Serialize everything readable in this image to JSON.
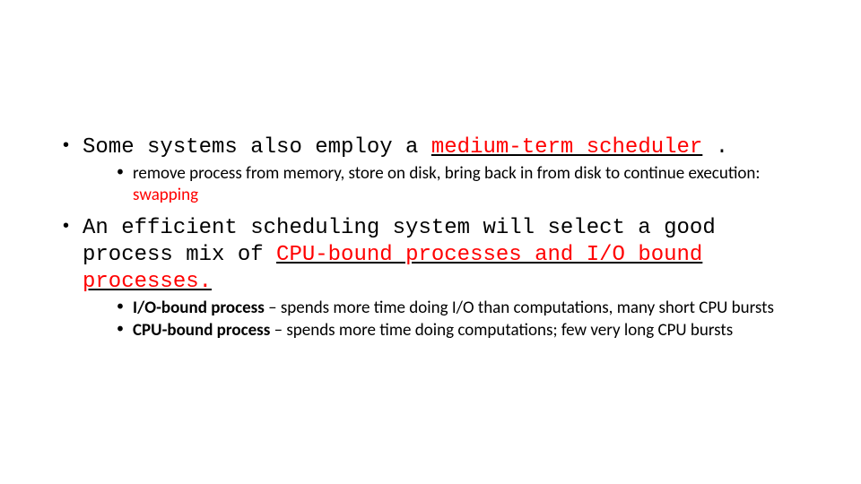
{
  "bullets": {
    "b1": {
      "text_a": "Some systems also employ a ",
      "em": "medium-term scheduler",
      "text_b": " ."
    },
    "b1s1": {
      "text_a": "remove process from memory, store on disk, bring back in from disk to continue execution: ",
      "em": "swapping"
    },
    "b2": {
      "text_a": "An efficient scheduling system will select a good process mix of ",
      "em": "CPU-bound processes and I/O bound processes."
    },
    "b2s1": {
      "em": "I/O-bound process",
      "text_a": " – spends more time doing I/O than computations, many short CPU bursts"
    },
    "b2s2": {
      "em": "CPU-bound process",
      "text_a": " – spends more time doing computations; few very long CPU bursts"
    }
  }
}
